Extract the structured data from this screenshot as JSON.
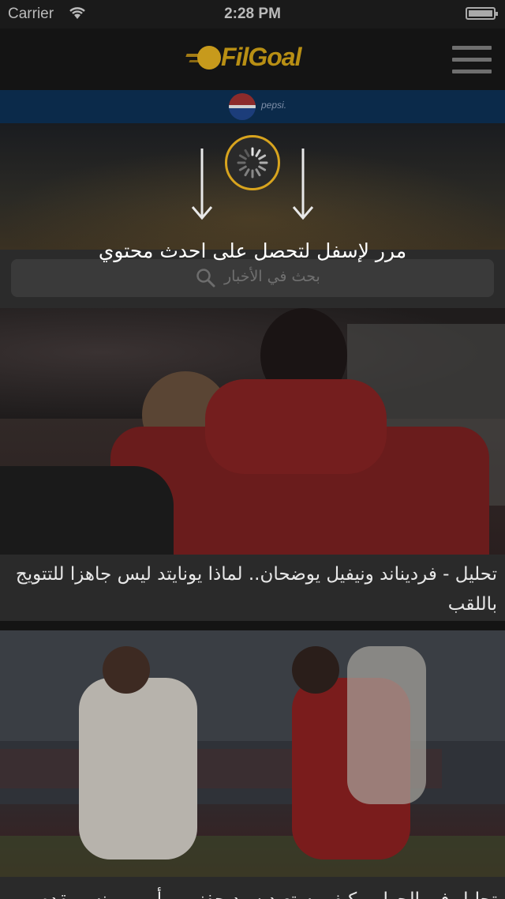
{
  "status_bar": {
    "carrier": "Carrier",
    "time": "2:28 PM",
    "battery_level": 0.95
  },
  "header": {
    "logo_text": "FilGoal",
    "menu_icon": "hamburger-menu-icon"
  },
  "sponsor": {
    "brand": "pepsi."
  },
  "refresh": {
    "instruction": "مرر لإسفل لتحصل على احدث محتوي",
    "spinner_icon": "loading-spinner-icon",
    "arrow_icon": "arrow-down-icon",
    "accent_color": "#d8a41e"
  },
  "search": {
    "placeholder": "بحث في الأخبار",
    "icon": "search-icon"
  },
  "articles": [
    {
      "title": "تحليل - فرديناند ونيفيل يوضحان.. لماذا يونايتد ليس جاهزا للتتويج باللقب"
    },
    {
      "title": "تحليل في الجول - كيف يستعيد سيد حفني .. أيمن يونس يقدم"
    }
  ]
}
